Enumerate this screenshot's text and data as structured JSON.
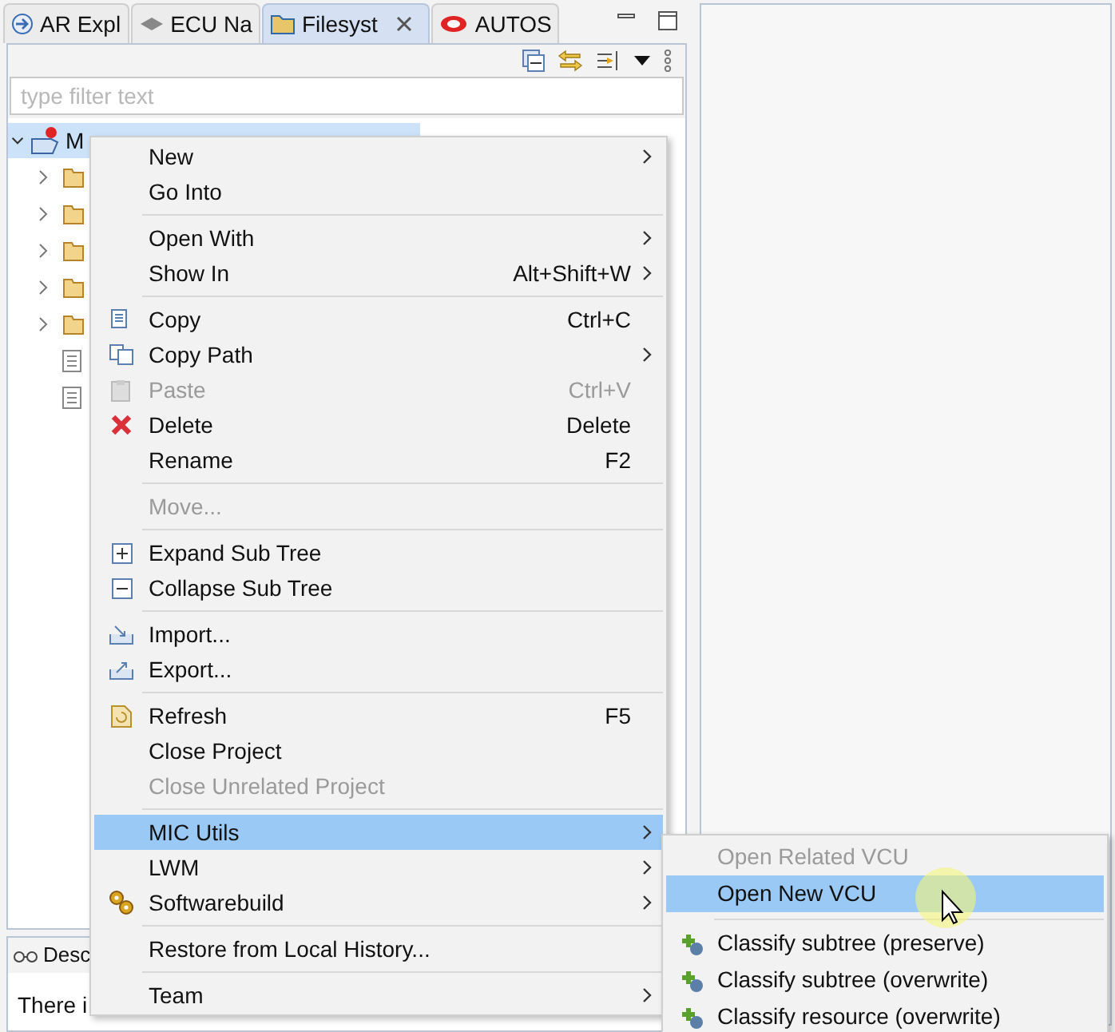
{
  "tabs": [
    {
      "label": "AR Expl",
      "selected": false,
      "closable": false
    },
    {
      "label": "ECU Na",
      "selected": false,
      "closable": false
    },
    {
      "label": "Filesyst",
      "selected": true,
      "closable": true
    },
    {
      "label": "AUTOS",
      "selected": false,
      "closable": false
    }
  ],
  "filter": {
    "placeholder": "type filter text"
  },
  "tree": [
    {
      "label": "M",
      "expanded": true,
      "selected": true,
      "children": [
        {
          "kind": "folder",
          "expanded": false
        },
        {
          "kind": "folder",
          "expanded": false
        },
        {
          "kind": "folder",
          "expanded": false
        },
        {
          "kind": "folder",
          "expanded": false
        },
        {
          "kind": "folder",
          "expanded": false
        },
        {
          "kind": "file"
        },
        {
          "kind": "file"
        }
      ]
    }
  ],
  "bottom_panel": {
    "tab": "Desc",
    "text": "There i"
  },
  "context_menu": [
    {
      "kind": "item",
      "label": "New",
      "submenu": true,
      "disabled": false,
      "selected": false
    },
    {
      "kind": "item",
      "label": "Go Into",
      "submenu": false,
      "disabled": false,
      "selected": false
    },
    {
      "kind": "separator"
    },
    {
      "kind": "item",
      "label": "Open With",
      "submenu": true,
      "disabled": false,
      "selected": false
    },
    {
      "kind": "item",
      "label": "Show In",
      "shortcut": "Alt+Shift+W",
      "submenu": true,
      "disabled": false,
      "selected": false
    },
    {
      "kind": "separator"
    },
    {
      "kind": "item",
      "label": "Copy",
      "shortcut": "Ctrl+C",
      "submenu": false,
      "disabled": false,
      "selected": false
    },
    {
      "kind": "item",
      "label": "Copy Path",
      "submenu": true,
      "disabled": false,
      "selected": false
    },
    {
      "kind": "item",
      "label": "Paste",
      "shortcut": "Ctrl+V",
      "submenu": false,
      "disabled": true,
      "selected": false
    },
    {
      "kind": "item",
      "label": "Delete",
      "shortcut": "Delete",
      "submenu": false,
      "disabled": false,
      "selected": false
    },
    {
      "kind": "item",
      "label": "Rename",
      "shortcut": "F2",
      "submenu": false,
      "disabled": false,
      "selected": false
    },
    {
      "kind": "separator"
    },
    {
      "kind": "item",
      "label": "Move...",
      "submenu": false,
      "disabled": true,
      "selected": false
    },
    {
      "kind": "separator"
    },
    {
      "kind": "item",
      "label": "Expand Sub Tree",
      "submenu": false,
      "disabled": false,
      "selected": false
    },
    {
      "kind": "item",
      "label": "Collapse Sub Tree",
      "submenu": false,
      "disabled": false,
      "selected": false
    },
    {
      "kind": "separator"
    },
    {
      "kind": "item",
      "label": "Import...",
      "submenu": false,
      "disabled": false,
      "selected": false
    },
    {
      "kind": "item",
      "label": "Export...",
      "submenu": false,
      "disabled": false,
      "selected": false
    },
    {
      "kind": "separator"
    },
    {
      "kind": "item",
      "label": "Refresh",
      "shortcut": "F5",
      "submenu": false,
      "disabled": false,
      "selected": false
    },
    {
      "kind": "item",
      "label": "Close Project",
      "submenu": false,
      "disabled": false,
      "selected": false
    },
    {
      "kind": "item",
      "label": "Close Unrelated Project",
      "submenu": false,
      "disabled": true,
      "selected": false
    },
    {
      "kind": "separator"
    },
    {
      "kind": "item",
      "label": "MIC Utils",
      "submenu": true,
      "disabled": false,
      "selected": true
    },
    {
      "kind": "item",
      "label": "LWM",
      "submenu": true,
      "disabled": false,
      "selected": false
    },
    {
      "kind": "item",
      "label": "Softwarebuild",
      "submenu": true,
      "disabled": false,
      "selected": false
    },
    {
      "kind": "separator"
    },
    {
      "kind": "item",
      "label": "Restore from Local History...",
      "submenu": false,
      "disabled": false,
      "selected": false
    },
    {
      "kind": "separator"
    },
    {
      "kind": "item",
      "label": "Team",
      "submenu": true,
      "disabled": false,
      "selected": false
    }
  ],
  "submenu": [
    {
      "kind": "item",
      "label": "Open Related VCU",
      "disabled": true,
      "selected": false
    },
    {
      "kind": "item",
      "label": "Open New VCU",
      "disabled": false,
      "selected": true
    },
    {
      "kind": "separator"
    },
    {
      "kind": "item",
      "label": "Classify subtree (preserve)",
      "disabled": false,
      "selected": false
    },
    {
      "kind": "item",
      "label": "Classify subtree (overwrite)",
      "disabled": false,
      "selected": false
    },
    {
      "kind": "item",
      "label": "Classify resource (overwrite)",
      "disabled": false,
      "selected": false
    }
  ]
}
